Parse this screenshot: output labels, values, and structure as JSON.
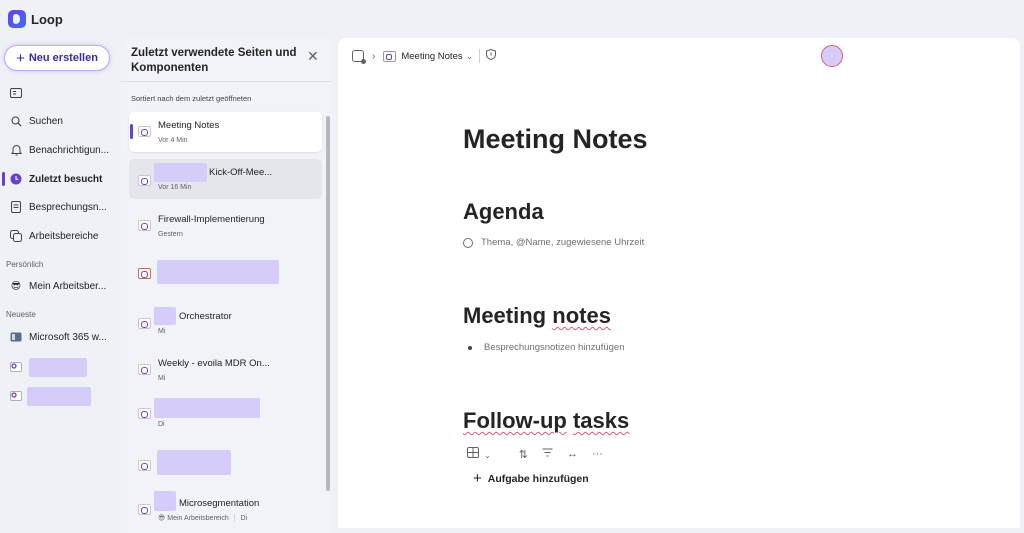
{
  "app": {
    "name": "Loop"
  },
  "leftnav": {
    "new_button": "Neu erstellen",
    "items": [
      {
        "label": "",
        "icon": "panel-icon"
      },
      {
        "label": "Suchen",
        "icon": "search-icon"
      },
      {
        "label": "Benachrichtigun...",
        "icon": "bell-icon"
      },
      {
        "label": "Zuletzt besucht",
        "icon": "clock-icon",
        "active": true
      },
      {
        "label": "Besprechungsn...",
        "icon": "notes-icon"
      },
      {
        "label": "Arbeitsbereiche",
        "icon": "workspaces-icon"
      }
    ],
    "personal_label": "Persönlich",
    "personal_items": [
      {
        "label": "Mein Arbeitsber..."
      }
    ],
    "recent_label": "Neueste",
    "recent_items": [
      {
        "label": "Microsoft 365 w..."
      }
    ]
  },
  "recent_panel": {
    "title": "Zuletzt verwendete Seiten und Komponenten",
    "close": "✕",
    "sort_label": "Sortiert nach dem zuletzt geöffneten",
    "items": [
      {
        "title": "Meeting Notes",
        "meta": "Vor 4 Min"
      },
      {
        "title": "Kick-Off-Mee...",
        "meta": "Vor 16 Min"
      },
      {
        "title": "Firewall-Implementierung",
        "meta": "Gestern"
      },
      {
        "title": "",
        "meta": ""
      },
      {
        "title": "Orchestrator",
        "meta": "Mi"
      },
      {
        "title": "Weekly - evoila MDR On...",
        "meta": "Mi"
      },
      {
        "title": "",
        "meta": "Di"
      },
      {
        "title": "",
        "meta": ""
      },
      {
        "title": "Microsegmentation",
        "meta": "Mein Arbeitsbereich",
        "meta2": "Di"
      }
    ]
  },
  "main": {
    "breadcrumb": {
      "page": "Meeting Notes",
      "chevron": "⌄"
    },
    "title": "Meeting Notes",
    "agenda_heading": "Agenda",
    "agenda_placeholder": "Thema, @Name, zugewiesene Uhrzeit",
    "notes_heading_1": "Meeting",
    "notes_heading_2": "notes",
    "notes_placeholder": "Besprechungsnotizen hinzufügen",
    "tasks_heading_1": "Follow-up",
    "tasks_heading_2": "tasks",
    "add_task": "Aufgabe hinzufügen"
  }
}
